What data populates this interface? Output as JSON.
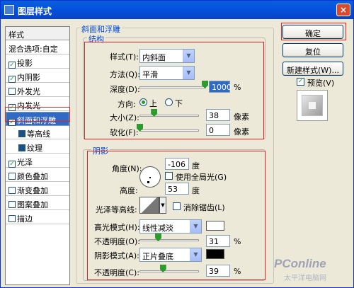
{
  "window": {
    "title": "图层样式",
    "close": "×"
  },
  "styles_panel": {
    "header": "样式",
    "blend": "混合选项:自定",
    "items": [
      {
        "label": "投影",
        "checked": true
      },
      {
        "label": "内阴影",
        "checked": true
      },
      {
        "label": "外发光",
        "checked": false
      },
      {
        "label": "内发光",
        "checked": true
      },
      {
        "label": "斜面和浮雕",
        "checked": true,
        "selected": true
      },
      {
        "label": "等高线",
        "checked": false,
        "sub": true
      },
      {
        "label": "纹理",
        "checked": false,
        "sub": true
      },
      {
        "label": "光泽",
        "checked": true
      },
      {
        "label": "颜色叠加",
        "checked": false
      },
      {
        "label": "渐变叠加",
        "checked": false
      },
      {
        "label": "图案叠加",
        "checked": false
      },
      {
        "label": "描边",
        "checked": false
      }
    ]
  },
  "bevel": {
    "title": "斜面和浮雕",
    "structure": {
      "title": "结构",
      "style_label": "样式(T):",
      "style_value": "内斜面",
      "technique_label": "方法(Q):",
      "technique_value": "平滑",
      "depth_label": "深度(D):",
      "depth_value": "1000",
      "depth_unit": "%",
      "depth_fraction": 1.0,
      "direction_label": "方向:",
      "dir_up": "上",
      "dir_down": "下",
      "direction_selected": "上",
      "size_label": "大小(Z):",
      "size_value": "38",
      "size_unit": "像素",
      "size_fraction": 0.24,
      "soften_label": "软化(F):",
      "soften_value": "0",
      "soften_unit": "像素",
      "soften_fraction": 0.0
    },
    "shading": {
      "title": "阴影",
      "angle_label": "角度(N):",
      "angle_value": "-106",
      "angle_unit": "度",
      "global_light_label": "使用全局光(G)",
      "global_light_checked": false,
      "altitude_label": "高度:",
      "altitude_value": "53",
      "altitude_unit": "度",
      "gloss_label": "光泽等高线:",
      "antialias_label": "消除锯齿(L)",
      "antialias_checked": false,
      "highlight_mode_label": "高光模式(H):",
      "highlight_mode_value": "线性减淡",
      "highlight_color": "#ffffff",
      "opacity1_label": "不透明度(O):",
      "opacity1_value": "31",
      "opacity1_unit": "%",
      "opacity1_fraction": 0.31,
      "shadow_mode_label": "阴影模式(A):",
      "shadow_mode_value": "正片叠底",
      "shadow_color": "#000000",
      "opacity2_label": "不透明度(C):",
      "opacity2_value": "39",
      "opacity2_unit": "%",
      "opacity2_fraction": 0.39
    }
  },
  "buttons": {
    "ok": "确定",
    "reset": "复位",
    "new_style": "新建样式(W)...",
    "preview": "预览(V)",
    "preview_checked": true
  },
  "watermark": {
    "brand": "PConline",
    "sub": "太平洋电脑网"
  }
}
